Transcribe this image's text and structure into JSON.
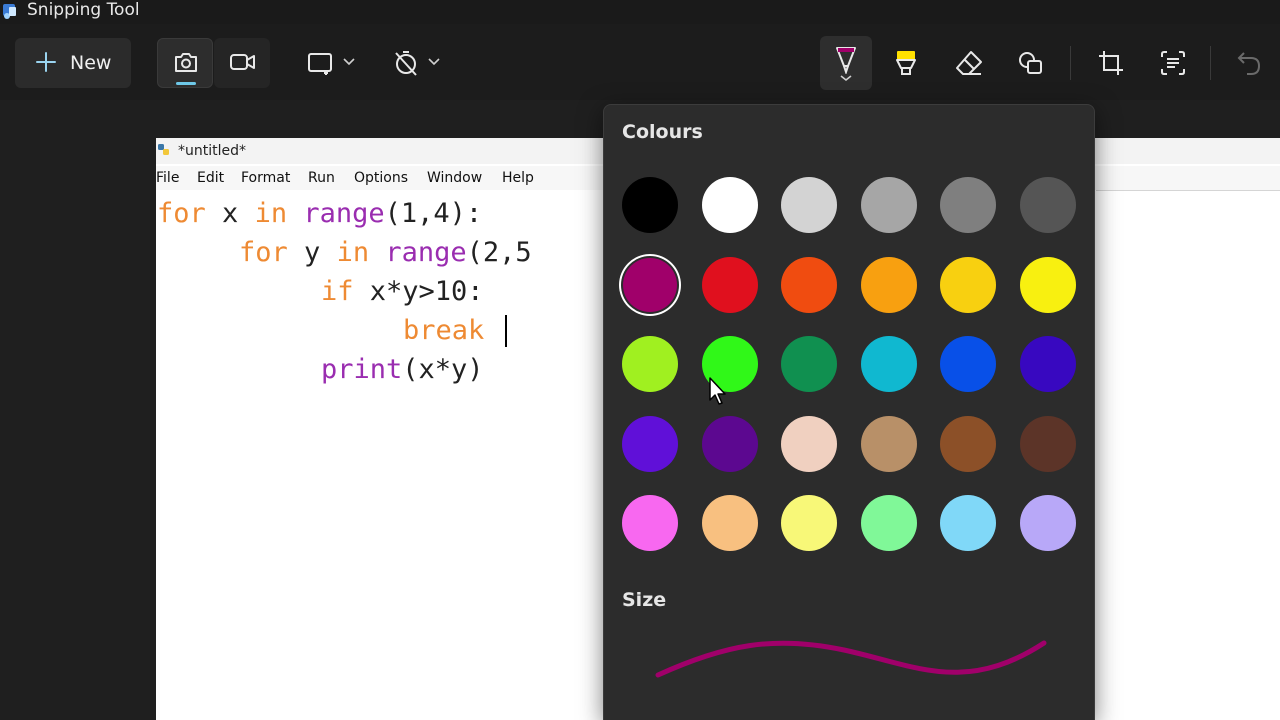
{
  "window": {
    "title": "Snipping Tool"
  },
  "toolbar": {
    "new_label": "New",
    "icons": {
      "new": "plus-icon",
      "screenshot": "camera-icon",
      "video": "video-camera-icon",
      "shape": "rectangle-snip-icon",
      "delay": "timer-off-icon",
      "pen": "ballpoint-pen-icon",
      "highlighter": "highlighter-icon",
      "eraser": "eraser-icon",
      "shapes": "shapes-icon",
      "crop": "crop-icon",
      "text_actions": "text-actions-icon",
      "undo": "undo-icon"
    },
    "pen_color": "#a0006a",
    "highlighter_color": "#ffe000"
  },
  "idle": {
    "title": "*untitled*",
    "menu": [
      "File",
      "Edit",
      "Format",
      "Run",
      "Options",
      "Window",
      "Help"
    ],
    "code": {
      "l1": {
        "k1": "for",
        "t1": " x ",
        "k2": "in",
        "t2": " ",
        "b1": "range",
        "t3": "(1,4):"
      },
      "l2": {
        "k1": "for",
        "t1": " y ",
        "k2": "in",
        "t2": " ",
        "b1": "range",
        "t3": "(2,5"
      },
      "l3": {
        "k1": "if",
        "t1": " x*y>10:"
      },
      "l4": {
        "k1": "break"
      },
      "l5": {
        "b1": "print",
        "t1": "(x*y)"
      }
    }
  },
  "colour_panel": {
    "heading": "Colours",
    "selected_index": 6,
    "swatches": [
      "#000000",
      "#ffffff",
      "#d3d3d3",
      "#a6a6a6",
      "#7f7f7f",
      "#555555",
      "#a0006a",
      "#e0101e",
      "#f04c10",
      "#f8a010",
      "#f8d010",
      "#f8f010",
      "#a0f020",
      "#30f818",
      "#109050",
      "#10b8d0",
      "#0850e8",
      "#3808c0",
      "#6010d8",
      "#5c0890",
      "#f0d0c0",
      "#b89068",
      "#8c5028",
      "#5c3428",
      "#f868f0",
      "#f8c080",
      "#f8f878",
      "#80f898",
      "#80d8f8",
      "#b8a8f8"
    ],
    "size_heading": "Size",
    "stroke_color": "#a0006a"
  },
  "cursor": {
    "icon": "mouse-pointer-icon"
  }
}
